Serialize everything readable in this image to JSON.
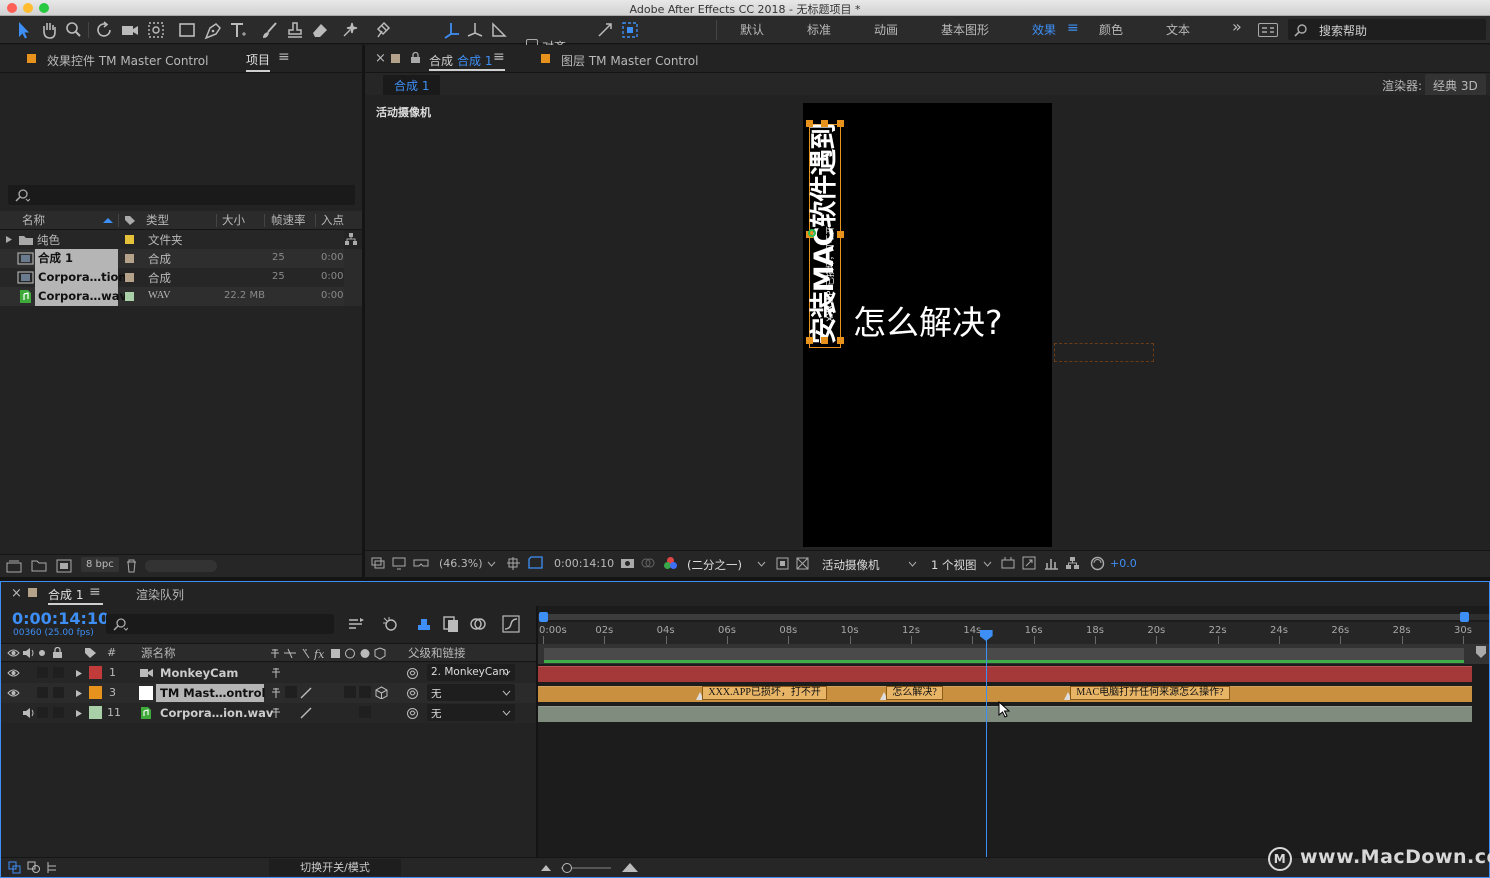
{
  "app": {
    "window_title": "Adobe After Effects CC 2018 - 无标题项目 *"
  },
  "toolbar": {
    "snap_label": "对齐"
  },
  "workspaces": {
    "items": [
      "默认",
      "标准",
      "动画",
      "基本图形",
      "效果",
      "颜色",
      "文本"
    ],
    "active": "效果",
    "overflow": "»",
    "search_placeholder": "搜索帮助"
  },
  "left_panel": {
    "tab_effects": "效果控件 TM Master Control",
    "tab_project": "项目",
    "menu_icon": "≡",
    "columns": [
      "名称",
      "类型",
      "大小",
      "帧速率",
      "入点"
    ],
    "items": [
      {
        "name": "纯色",
        "type": "文件夹",
        "size": "",
        "fps": "",
        "in": ""
      },
      {
        "name": "合成 1",
        "type": "合成",
        "size": "",
        "fps": "25",
        "in": "0:00:"
      },
      {
        "name": "Corpora…tion",
        "type": "合成",
        "size": "",
        "fps": "25",
        "in": "0:00:"
      },
      {
        "name": "Corpora…wav",
        "type": "WAV",
        "size": "22.2 MB",
        "fps": "",
        "in": "0:00:"
      }
    ],
    "bpc": "8 bpc"
  },
  "comp_panel": {
    "close": "×",
    "tab_prefix": "合成",
    "tab_name": "合成 1",
    "tab_layer": "图层 TM Master Control",
    "breadcrumb": "合成 1",
    "renderer_label": "渲染器:",
    "renderer_value": "经典 3D",
    "camera_label": "活动摄像机",
    "preview_text_vertical": "安装MAC软件遇到",
    "preview_text_small": "XXX.APP已损坏，打不开",
    "preview_text_horizontal": "怎么解决?",
    "footer": {
      "zoom": "(46.3%)",
      "time": "0:00:14:10",
      "resolution": "(二分之一)",
      "camera": "活动摄像机",
      "views": "1 个视图",
      "exposure": "+0.0"
    }
  },
  "timeline": {
    "tab_comp": "合成 1",
    "tab_render": "渲染队列",
    "timecode": "0:00:14:10",
    "frame_info": "00360 (25.00 fps)",
    "col_number": "#",
    "col_source": "源名称",
    "col_parent": "父级和链接",
    "ruler": [
      "0:00s",
      "02s",
      "04s",
      "06s",
      "08s",
      "10s",
      "12s",
      "14s",
      "16s",
      "18s",
      "20s",
      "22s",
      "24s",
      "26s",
      "28s",
      "30s"
    ],
    "playhead_seconds": 14.4,
    "duration_seconds": 30,
    "layers": [
      {
        "num": "1",
        "name": "MonkeyCam",
        "parent": "2. MonkeyCam",
        "color": "#c23b3b",
        "bar_color": "#a5393a"
      },
      {
        "num": "3",
        "name": "TM Mast…ontrol",
        "parent": "无",
        "color": "#e7921c",
        "bar_color": "#c9903f"
      },
      {
        "num": "11",
        "name": "Corpora…ion.wav",
        "parent": "无",
        "color": "#a9cfa8",
        "bar_color": "#7f8c7e"
      }
    ],
    "markers": [
      {
        "time": 5.1,
        "label": "XXX.APP已损坏，打不开"
      },
      {
        "time": 11.1,
        "label": "怎么解决?"
      },
      {
        "time": 17.1,
        "label": "MAC电脑打开任何来源怎么操作?"
      }
    ],
    "footer_toggle": "切换开关/模式"
  },
  "watermark": "www.MacDown.com",
  "colors": {
    "accent": "#3e8ff5",
    "orange": "#e7921c",
    "bg": "#1d1d1d"
  }
}
